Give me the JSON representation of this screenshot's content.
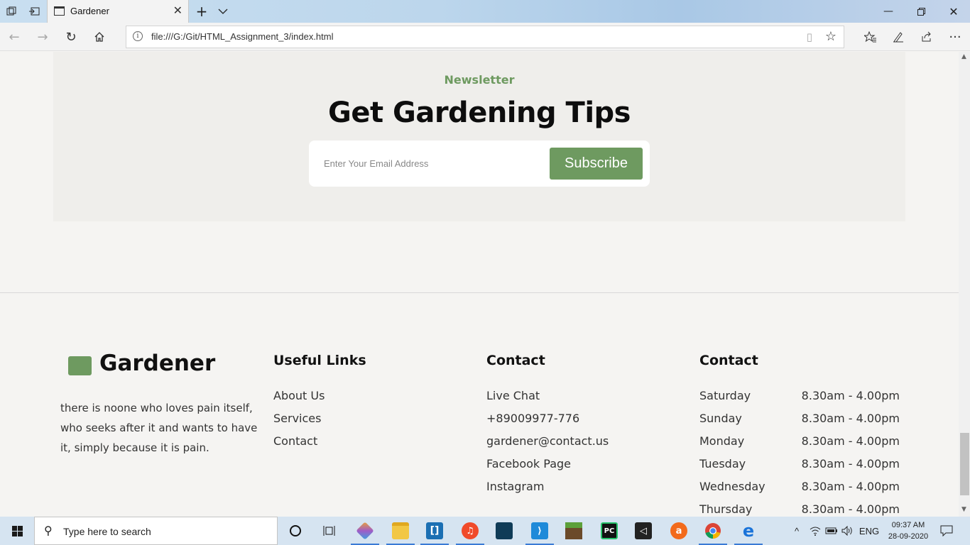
{
  "browser": {
    "tab_title": "Gardener",
    "address": "file:///G:/Git/HTML_Assignment_3/index.html",
    "icons": {
      "tab_actions": "tab-set-aside-icon",
      "tab_preview": "tab-preview-icon",
      "new_tab": "plus-icon",
      "tab_list": "chevron-down-icon",
      "back": "arrow-left-icon",
      "forward": "arrow-right-icon",
      "refresh": "refresh-icon",
      "home": "home-icon",
      "favorites": "favorites-icon",
      "notes": "pen-icon",
      "share": "share-icon",
      "more": "ellipsis-icon"
    }
  },
  "newsletter": {
    "kicker": "Newsletter",
    "title": "Get Gardening Tips",
    "email_placeholder": "Enter Your Email Address",
    "subscribe_label": "Subscribe"
  },
  "footer": {
    "brand": "Gardener",
    "about": "there is noone who loves pain itself, who seeks after it and wants to have it, simply because it is pain.",
    "useful_links": {
      "title": "Useful Links",
      "items": [
        "About Us",
        "Services",
        "Contact"
      ]
    },
    "contact": {
      "title": "Contact",
      "items": [
        "Live Chat",
        "+89009977-776",
        "gardener@contact.us",
        "Facebook Page",
        "Instagram"
      ]
    },
    "hours": {
      "title": "Contact",
      "rows": [
        {
          "day": "Saturday",
          "time": "8.30am - 4.00pm"
        },
        {
          "day": "Sunday",
          "time": "8.30am - 4.00pm"
        },
        {
          "day": "Monday",
          "time": "8.30am - 4.00pm"
        },
        {
          "day": "Tuesday",
          "time": "8.30am - 4.00pm"
        },
        {
          "day": "Wednesday",
          "time": "8.30am - 4.00pm"
        },
        {
          "day": "Thursday",
          "time": "8.30am - 4.00pm"
        }
      ]
    }
  },
  "taskbar": {
    "search_placeholder": "Type here to search",
    "language": "ENG",
    "time": "09:37 AM",
    "date": "28-09-2020"
  },
  "colors": {
    "accent_green": "#6e9a60",
    "page_bg": "#f5f4f2",
    "newsletter_bg": "#efeeeb"
  }
}
